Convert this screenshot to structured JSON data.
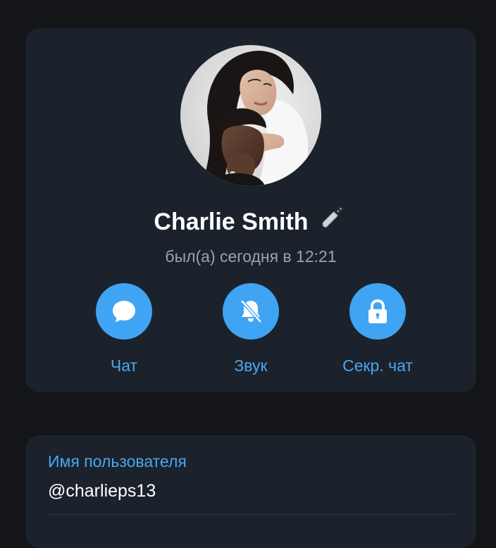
{
  "profile": {
    "name": "Charlie Smith",
    "name_emoji": "knife-emoji",
    "status": "был(а) сегодня в 12:21",
    "avatar": "profile-photo"
  },
  "actions": [
    {
      "label": "Чат",
      "icon": "chat-bubble-icon"
    },
    {
      "label": "Звук",
      "icon": "bell-muted-icon"
    },
    {
      "label": "Секр. чат",
      "icon": "lock-icon"
    }
  ],
  "info": {
    "username_label": "Имя пользователя",
    "username_value": "@charlieps13"
  },
  "colors": {
    "background": "#131518",
    "card": "#1b222c",
    "accent": "#3fa4f4",
    "accent_text": "#4aa6ee",
    "secondary_text": "#9aa3ad"
  }
}
